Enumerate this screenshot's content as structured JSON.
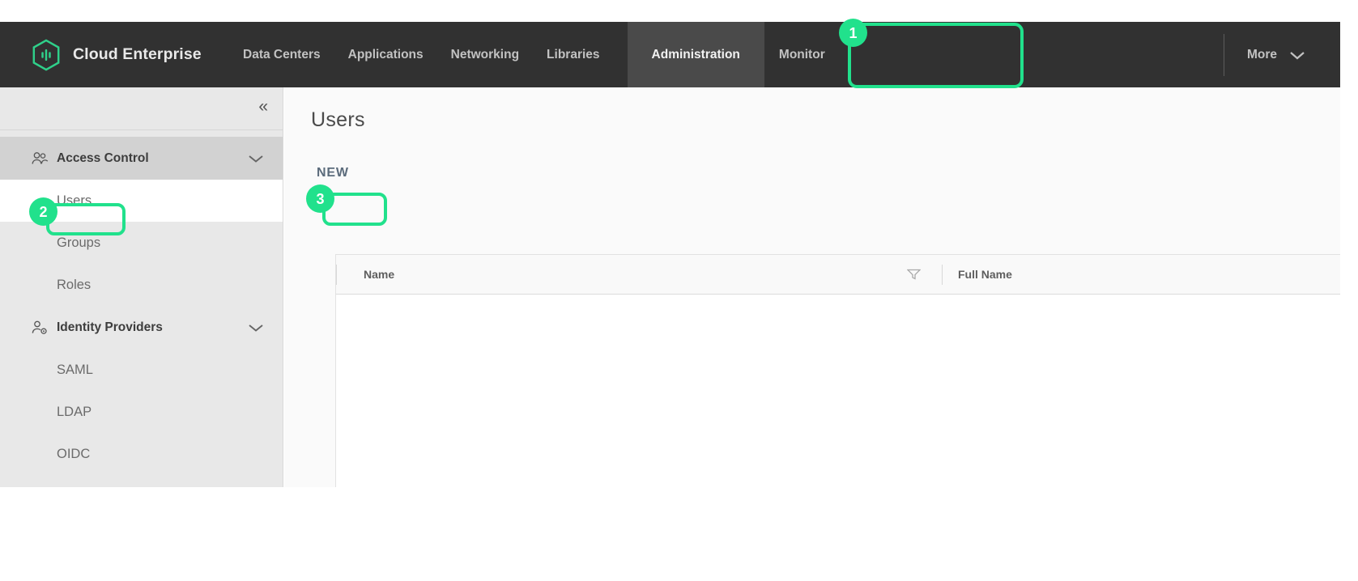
{
  "brand": {
    "title": "Cloud Enterprise",
    "logo_icon": "hexagon-signal-logo-icon"
  },
  "topnav": {
    "items": [
      {
        "label": "Data Centers",
        "id": "data-centers"
      },
      {
        "label": "Applications",
        "id": "applications"
      },
      {
        "label": "Networking",
        "id": "networking"
      },
      {
        "label": "Libraries",
        "id": "libraries"
      },
      {
        "label": "Administration",
        "id": "administration",
        "active": true
      },
      {
        "label": "Monitor",
        "id": "monitor"
      }
    ],
    "more_label": "More",
    "more_chevron_icon": "chevron-down-icon"
  },
  "sidebar": {
    "collapse_icon": "double-chevron-left-icon",
    "collapse_label": "«",
    "groups": [
      {
        "label": "Access Control",
        "icon": "users-group-icon",
        "chevron_icon": "chevron-down-icon",
        "items": [
          {
            "label": "Users",
            "active": true
          },
          {
            "label": "Groups"
          },
          {
            "label": "Roles"
          }
        ]
      },
      {
        "label": "Identity Providers",
        "icon": "user-settings-icon",
        "chevron_icon": "chevron-down-icon",
        "items": [
          {
            "label": "SAML"
          },
          {
            "label": "LDAP"
          },
          {
            "label": "OIDC"
          }
        ]
      }
    ]
  },
  "main": {
    "page_title": "Users",
    "new_button_label": "NEW",
    "table": {
      "columns": [
        {
          "label": "Name",
          "filter_icon": "filter-icon"
        },
        {
          "label": "Full Name"
        }
      ],
      "rows": []
    }
  },
  "annotations": {
    "color": "#21e18c",
    "steps": [
      {
        "number": "1",
        "target": "Administration"
      },
      {
        "number": "2",
        "target": "Users"
      },
      {
        "number": "3",
        "target": "NEW"
      }
    ]
  }
}
